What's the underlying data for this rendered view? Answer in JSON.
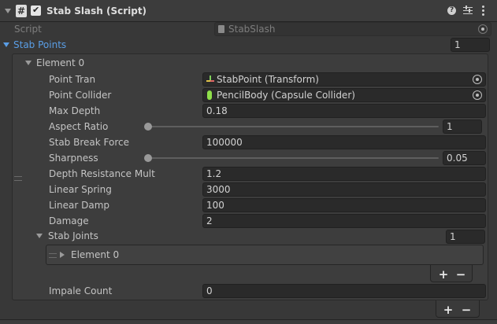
{
  "component": {
    "title": "Stab Slash (Script)",
    "enabled": "✔"
  },
  "script_row": {
    "label": "Script",
    "value": "StabSlash"
  },
  "stab_points": {
    "label": "Stab Points",
    "size": "1",
    "element": {
      "label": "Element 0",
      "point_tran": {
        "label": "Point Tran",
        "value": "StabPoint (Transform)"
      },
      "point_collider": {
        "label": "Point Collider",
        "value": "PencilBody (Capsule Collider)"
      },
      "max_depth": {
        "label": "Max Depth",
        "value": "0.18"
      },
      "aspect_ratio": {
        "label": "Aspect Ratio",
        "value": "1",
        "slider_fraction": 0
      },
      "stab_break_force": {
        "label": "Stab Break Force",
        "value": "100000"
      },
      "sharpness": {
        "label": "Sharpness",
        "value": "0.05",
        "slider_fraction": 0
      },
      "depth_resistance_mult": {
        "label": "Depth Resistance Mult",
        "value": "1.2"
      },
      "linear_spring": {
        "label": "Linear Spring",
        "value": "3000"
      },
      "linear_damp": {
        "label": "Linear Damp",
        "value": "100"
      },
      "damage": {
        "label": "Damage",
        "value": "2"
      },
      "stab_joints": {
        "label": "Stab Joints",
        "size": "1",
        "element_label": "Element 0"
      },
      "impale_count": {
        "label": "Impale Count",
        "value": "0"
      }
    }
  },
  "buttons": {
    "add": "+",
    "remove": "−"
  },
  "icons": {
    "collapse": "chevron-down-icon",
    "script": "csharp-script-icon",
    "help": "help-icon",
    "presets": "presets-icon",
    "menu": "kebab-menu-icon"
  },
  "colors": {
    "accent": "#5a9ee6",
    "header_bg": "#3c3c3c",
    "field_bg": "#2a2a2a"
  }
}
